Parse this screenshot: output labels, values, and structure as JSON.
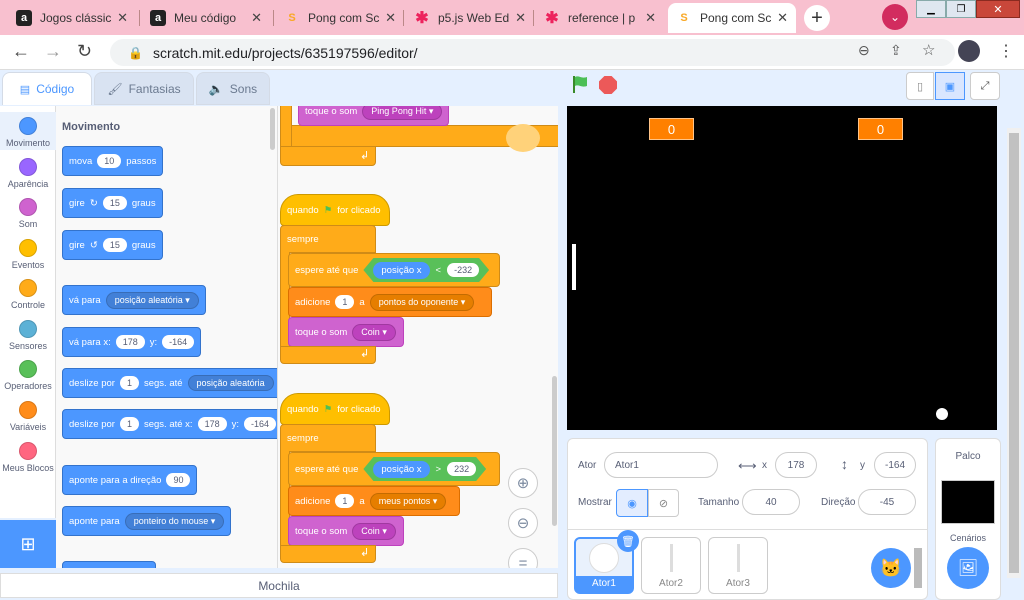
{
  "browser": {
    "tabs": [
      {
        "icon": "a",
        "title": "Jogos clássic"
      },
      {
        "icon": "a",
        "title": "Meu código"
      },
      {
        "icon": "S",
        "title": "Pong com Sc"
      },
      {
        "icon": "✱",
        "title": "p5.js Web Ed"
      },
      {
        "icon": "✱",
        "title": "reference | p"
      },
      {
        "icon": "S",
        "title": "Pong com Sc"
      }
    ],
    "url": "scratch.mit.edu/projects/635197596/editor/"
  },
  "editor_tabs": {
    "code": "Código",
    "costumes": "Fantasias",
    "sounds": "Sons"
  },
  "categories": [
    "Movimento",
    "Aparência",
    "Som",
    "Eventos",
    "Controle",
    "Sensores",
    "Operadores",
    "Variáveis",
    "Meus Blocos"
  ],
  "category_colors": [
    "#4c97ff",
    "#9966ff",
    "#cf63cf",
    "#ffbf00",
    "#ffab19",
    "#5cb1d6",
    "#59c059",
    "#ff8c1a",
    "#ff6680"
  ],
  "palette": {
    "heading": "Movimento",
    "move": {
      "a": "mova",
      "n": "10",
      "b": "passos"
    },
    "turn_right": {
      "a": "gire",
      "n": "15",
      "b": "graus"
    },
    "turn_left": {
      "a": "gire",
      "n": "15",
      "b": "graus"
    },
    "goto": {
      "a": "vá para",
      "d": "posição aleatória"
    },
    "goto_xy": {
      "a": "vá para x:",
      "x": "178",
      "y_lbl": "y:",
      "y": "-164"
    },
    "glide": {
      "a": "deslize por",
      "n": "1",
      "b": "segs. até",
      "d": "posição aleatória"
    },
    "glide_xy": {
      "a": "deslize por",
      "n": "1",
      "b": "segs. até x:",
      "x": "178",
      "y_lbl": "y:",
      "y": "-164"
    },
    "point_dir": {
      "a": "aponte  para a direção",
      "n": "90"
    },
    "point_to": {
      "a": "aponte para",
      "d": "ponteiro do mouse"
    }
  },
  "workspace": {
    "top_sound": {
      "a": "toque o som",
      "d": "Ping Pong Hit"
    },
    "script1": {
      "hat": "quando",
      "hat2": "for clicado",
      "forever": "sempre",
      "wait": "espere até que",
      "rep": "posição x",
      "op": "<",
      "val": "-232",
      "add": "adicione",
      "n": "1",
      "to": "a",
      "var": "pontos do oponente",
      "sound": "toque o som",
      "snd": "Coin"
    },
    "script2": {
      "hat": "quando",
      "hat2": "for clicado",
      "forever": "sempre",
      "wait": "espere até que",
      "rep": "posição x",
      "op": ">",
      "val": "232",
      "add": "adicione",
      "n": "1",
      "to": "a",
      "var": "meus pontos",
      "sound": "toque o som",
      "snd": "Coin"
    }
  },
  "backpack": "Mochila",
  "stage": {
    "score_left": "0",
    "score_right": "0"
  },
  "sprite_info": {
    "actor_lbl": "Ator",
    "actor": "Ator1",
    "x_lbl": "x",
    "x": "178",
    "y_lbl": "y",
    "y": "-164",
    "show_lbl": "Mostrar",
    "size_lbl": "Tamanho",
    "size": "40",
    "dir_lbl": "Direção",
    "dir": "-45"
  },
  "sprites": [
    "Ator1",
    "Ator2",
    "Ator3"
  ],
  "stage_panel": {
    "title": "Palco",
    "backdrops": "Cenários"
  }
}
